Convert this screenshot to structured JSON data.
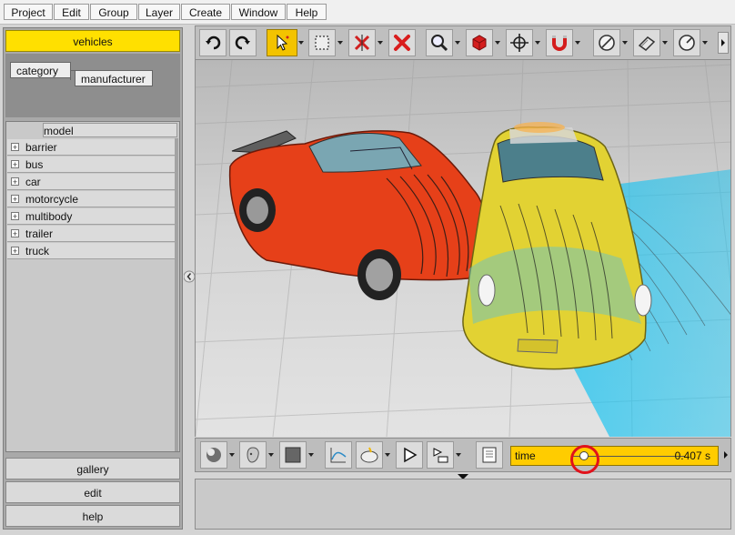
{
  "menu": {
    "items": [
      "Project",
      "Edit",
      "Group",
      "Layer",
      "Create",
      "Window",
      "Help"
    ]
  },
  "sidebar": {
    "active_tab": "vehicles",
    "filters": [
      "category",
      "manufacturer"
    ],
    "column_header": "model",
    "items": [
      {
        "label": "barrier",
        "expander": "+"
      },
      {
        "label": "bus",
        "expander": "+"
      },
      {
        "label": "car",
        "expander": "+"
      },
      {
        "label": "motorcycle",
        "expander": "+"
      },
      {
        "label": "multibody",
        "expander": "+"
      },
      {
        "label": "trailer",
        "expander": "+"
      },
      {
        "label": "truck",
        "expander": "+"
      }
    ],
    "bottom_tabs": [
      "gallery",
      "edit",
      "help"
    ]
  },
  "toolbar_top": {
    "icons": [
      "undo-icon",
      "redo-icon",
      "select-cursor-icon",
      "selection-box-icon",
      "delete-link-icon",
      "delete-icon",
      "zoom-icon",
      "cube-icon",
      "move-icon",
      "magnet-icon",
      "measure-angle-icon",
      "measure-plane-icon",
      "measure-distance-icon"
    ]
  },
  "viewport": {
    "scene": "car-crash-simulation",
    "colors": {
      "porsche": "#e64019",
      "ferrari": "#e2d233",
      "deformation": "#18c4f6"
    }
  },
  "bottom_toolbar": {
    "icons": [
      "shading-sphere-icon",
      "head-icon",
      "square-fill-icon",
      "curve-icon",
      "camera-icon",
      "play-icon",
      "play-list-icon",
      "notes-icon"
    ],
    "time_label": "time",
    "time_value": "0.407 s",
    "time_position": 0.07,
    "accent_color": "#ffcc00",
    "highlight_color": "#e1121b"
  }
}
